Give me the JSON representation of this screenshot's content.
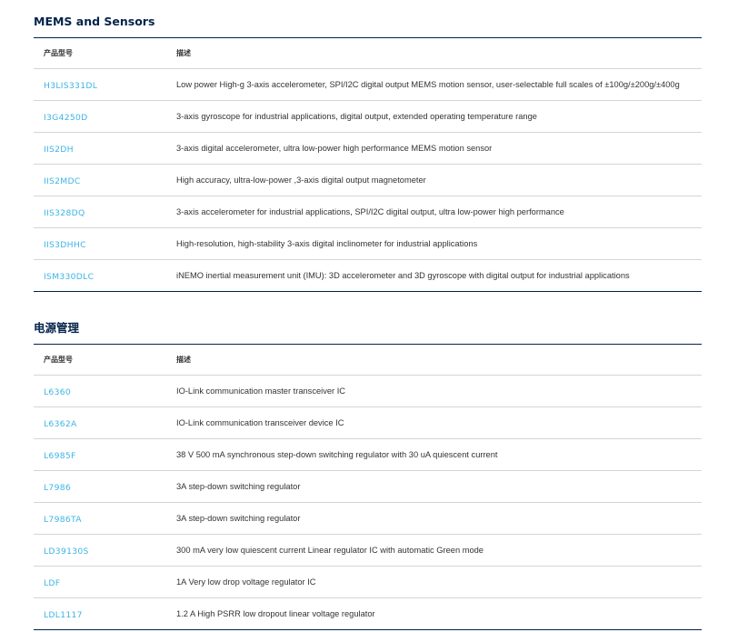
{
  "sections": [
    {
      "title": "MEMS and Sensors",
      "columns": [
        "产品型号",
        "描述"
      ],
      "rows": [
        {
          "part": "H3LIS331DL",
          "desc": "Low power High-g 3-axis accelerometer, SPI/I2C digital output MEMS motion sensor, user-selectable full scales of ±100g/±200g/±400g"
        },
        {
          "part": "I3G4250D",
          "desc": "3-axis gyroscope for industrial applications, digital output, extended operating temperature range"
        },
        {
          "part": "IIS2DH",
          "desc": "3-axis digital accelerometer, ultra low-power high performance MEMS motion sensor"
        },
        {
          "part": "IIS2MDC",
          "desc": "High accuracy, ultra-low-power ,3-axis digital output magnetometer"
        },
        {
          "part": "IIS328DQ",
          "desc": "3-axis accelerometer for industrial applications, SPI/I2C digital output, ultra low-power high performance"
        },
        {
          "part": "IIS3DHHC",
          "desc": "High-resolution, high-stability 3-axis digital inclinometer for industrial applications"
        },
        {
          "part": "ISM330DLC",
          "desc": "iNEMO inertial measurement unit (IMU): 3D accelerometer and 3D gyroscope with digital output for industrial applications"
        }
      ]
    },
    {
      "title": "电源管理",
      "columns": [
        "产品型号",
        "描述"
      ],
      "rows": [
        {
          "part": "L6360",
          "desc": "IO-Link communication master transceiver IC"
        },
        {
          "part": "L6362A",
          "desc": "IO-Link communication transceiver device IC"
        },
        {
          "part": "L6985F",
          "desc": "38 V 500 mA synchronous step-down switching regulator with 30 uA quiescent current"
        },
        {
          "part": "L7986",
          "desc": "3A step-down switching regulator"
        },
        {
          "part": "L7986TA",
          "desc": "3A step-down switching regulator"
        },
        {
          "part": "LD39130S",
          "desc": "300 mA very low quiescent current Linear regulator IC with automatic Green mode"
        },
        {
          "part": "LDF",
          "desc": "1A Very low drop voltage regulator IC"
        },
        {
          "part": "LDL1117",
          "desc": "1.2 A High PSRR low dropout linear voltage regulator"
        }
      ]
    }
  ]
}
